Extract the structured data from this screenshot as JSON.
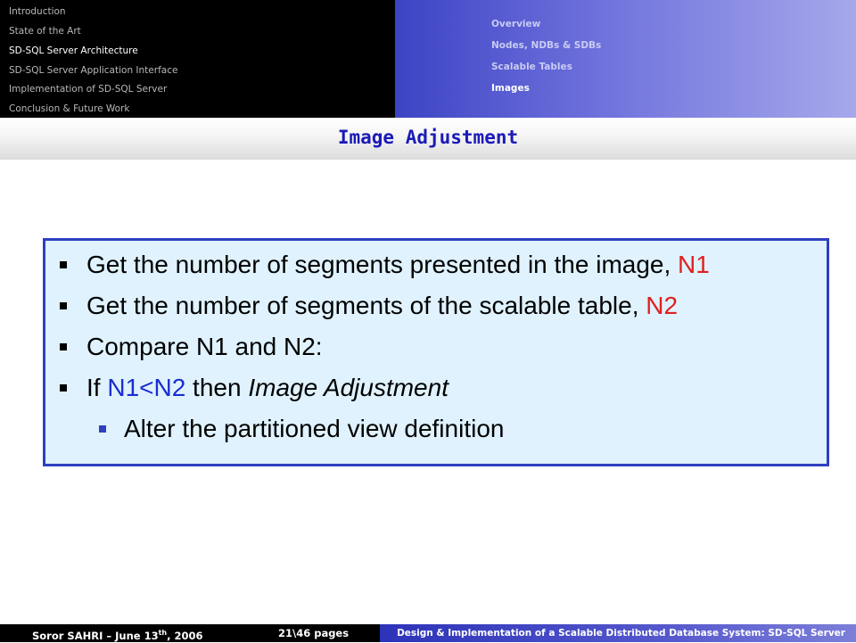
{
  "nav": {
    "sections": [
      {
        "label": "Introduction",
        "active": false
      },
      {
        "label": "State of the Art",
        "active": false
      },
      {
        "label": "SD-SQL Server Architecture",
        "active": true
      },
      {
        "label": "SD-SQL Server Application Interface",
        "active": false
      },
      {
        "label": "Implementation of SD-SQL Server",
        "active": false
      },
      {
        "label": "Conclusion & Future Work",
        "active": false
      }
    ],
    "subsections": [
      {
        "label": "Overview",
        "active": false
      },
      {
        "label": "Nodes, NDBs & SDBs",
        "active": false
      },
      {
        "label": "Scalable Tables",
        "active": false
      },
      {
        "label": "Images",
        "active": true
      }
    ]
  },
  "slide": {
    "title": "Image Adjustment",
    "bullets": {
      "b1_text": "Get the number of segments presented in the image, ",
      "b1_var": "N1",
      "b2_text": "Get the number of segments of the scalable table, ",
      "b2_var": "N2",
      "b3_text": "Compare N1 and N2:",
      "b4_if": "If ",
      "b4_cond": "N1<N2",
      "b4_then": " then ",
      "b4_action": "Image Adjustment",
      "sub1_text": "Alter the partitioned view definition"
    }
  },
  "footer": {
    "author": "Soror SAHRI – June 13",
    "author_sup": "th",
    "author_year": ", 2006",
    "pages": "21\\46 pages",
    "deck_title": "Design & Implementation of a Scalable Distributed Database System: SD-SQL Server"
  },
  "colors": {
    "title_blue": "#1a1ab8",
    "box_border": "#2f3fc0",
    "box_fill": "#dff2fd",
    "var_red": "#e02020",
    "cond_blue": "#1a2ed0"
  }
}
